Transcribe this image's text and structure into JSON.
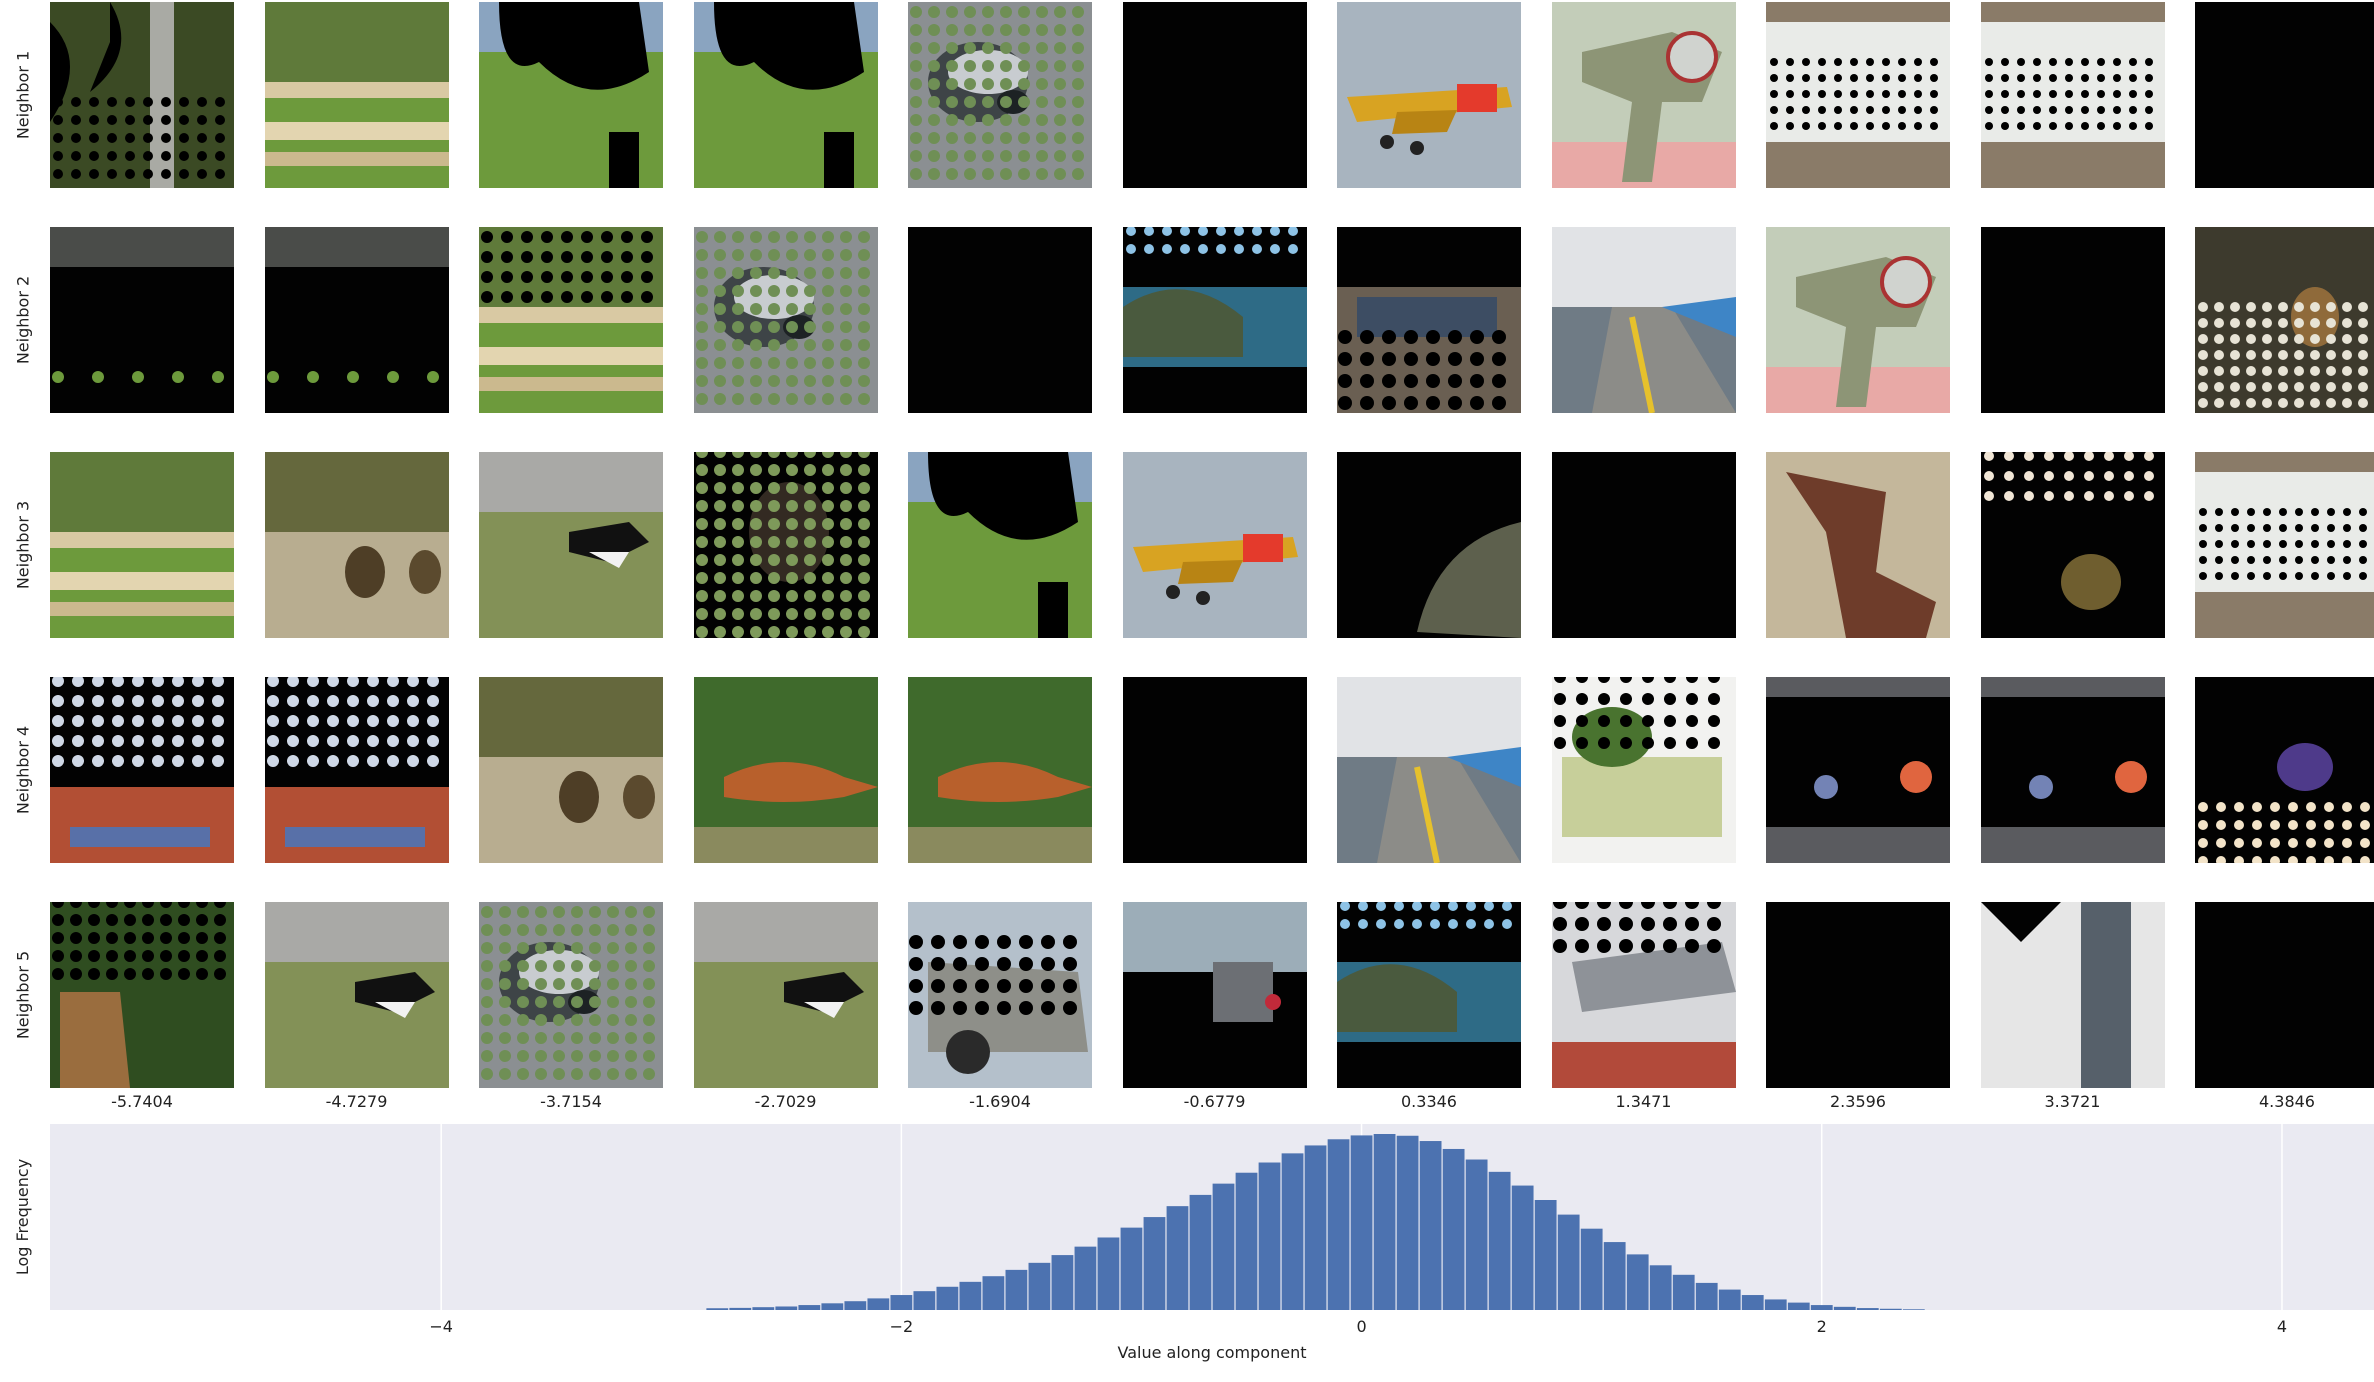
{
  "chart_data": {
    "type": "bar",
    "row_labels": [
      "Neighbor 1",
      "Neighbor 2",
      "Neighbor 3",
      "Neighbor 4",
      "Neighbor 5"
    ],
    "column_values": [
      "-5.7404",
      "-4.7279",
      "-3.7154",
      "-2.7029",
      "-1.6904",
      "-0.6779",
      "0.3346",
      "1.3471",
      "2.3596",
      "3.3721",
      "4.3846"
    ],
    "tile_contents": [
      [
        "masked-forest",
        "garden-planters",
        "masked-grass",
        "masked-grass",
        "skunk-masked",
        "black",
        "yellow-airplane",
        "ray-gun-toy",
        "bathtub-masked",
        "bathtub-masked",
        "black"
      ],
      [
        "masked-dark",
        "masked-dark",
        "garden-planters-masked",
        "skunk-masked",
        "black",
        "coast-masked",
        "market-masked",
        "pier-sea",
        "ray-gun-toy",
        "black",
        "insect-masked"
      ],
      [
        "garden-planters",
        "monkeys-enclosure",
        "dog-running",
        "animal-masked",
        "masked-grass",
        "yellow-airplane",
        "black-masked",
        "black",
        "boot-masked",
        "object-masked",
        "bathtub-masked"
      ],
      [
        "red-vehicle-masked",
        "red-vehicle-masked",
        "monkeys-enclosure",
        "fox-running",
        "fox-running",
        "black",
        "pier-sea",
        "green-toy-masked",
        "fruit-masked",
        "fruit-masked",
        "purple-toy-masked"
      ],
      [
        "deer-masked",
        "dog-running",
        "skunk-masked",
        "dog-running",
        "military-truck",
        "ship-masked",
        "coast-masked",
        "rocket-masked",
        "black",
        "white-panel-masked",
        "black"
      ]
    ],
    "ylabel": "Log Frequency",
    "xlabel": "Value along component",
    "xticks": [
      -4,
      -2,
      0,
      2,
      4
    ],
    "xtick_labels": [
      "−4",
      "−2",
      "0",
      "2",
      "4"
    ],
    "xlim": [
      -5.7,
      4.4
    ],
    "ylim": [
      0,
      1
    ],
    "grid": true,
    "bins": [
      -2.8,
      -2.7,
      -2.6,
      -2.5,
      -2.4,
      -2.3,
      -2.2,
      -2.1,
      -2.0,
      -1.9,
      -1.8,
      -1.7,
      -1.6,
      -1.5,
      -1.4,
      -1.3,
      -1.2,
      -1.1,
      -1.0,
      -0.9,
      -0.8,
      -0.7,
      -0.6,
      -0.5,
      -0.4,
      -0.3,
      -0.2,
      -0.1,
      0.0,
      0.1,
      0.2,
      0.3,
      0.4,
      0.5,
      0.6,
      0.7,
      0.8,
      0.9,
      1.0,
      1.1,
      1.2,
      1.3,
      1.4,
      1.5,
      1.6,
      1.7,
      1.8,
      1.9,
      2.0,
      2.1,
      2.2,
      2.3,
      2.4
    ],
    "values": [
      0.01,
      0.012,
      0.016,
      0.02,
      0.028,
      0.038,
      0.05,
      0.066,
      0.085,
      0.107,
      0.132,
      0.16,
      0.192,
      0.228,
      0.268,
      0.312,
      0.36,
      0.412,
      0.468,
      0.528,
      0.59,
      0.654,
      0.718,
      0.78,
      0.838,
      0.89,
      0.935,
      0.97,
      0.992,
      1.0,
      0.99,
      0.96,
      0.915,
      0.855,
      0.785,
      0.707,
      0.625,
      0.542,
      0.462,
      0.386,
      0.316,
      0.254,
      0.2,
      0.154,
      0.116,
      0.085,
      0.06,
      0.042,
      0.028,
      0.018,
      0.011,
      0.007,
      0.004
    ],
    "colors": {
      "bar": "#4c72b0",
      "plot_bg": "#eaeaf2",
      "grid": "#ffffff"
    }
  }
}
